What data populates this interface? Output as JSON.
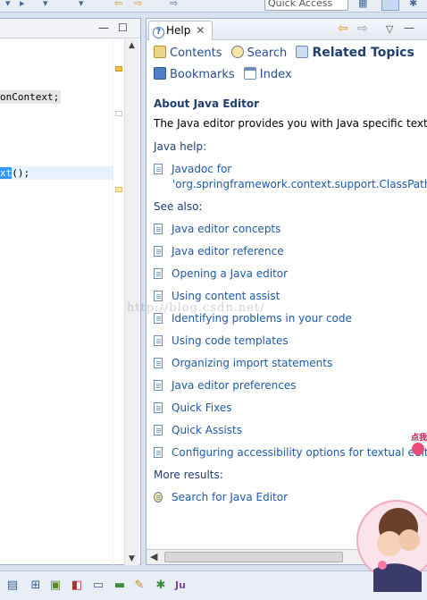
{
  "toolbar": {
    "quick_access_placeholder": "Quick Access"
  },
  "editor": {
    "code_line_1": "onContext;",
    "code_line_2_selected": "xt",
    "code_line_2_rest": "();"
  },
  "help": {
    "tab_label": "Help",
    "nav": {
      "contents": "Contents",
      "search": "Search",
      "related_topics": "Related Topics",
      "bookmarks": "Bookmarks",
      "index": "Index"
    },
    "title": "About Java Editor",
    "intro": "The Java editor provides you with Java specific text e",
    "java_help_heading": "Java help:",
    "javadoc_line1": "Javadoc for",
    "javadoc_line2": "'org.springframework.context.support.ClassPathX",
    "see_also_heading": "See also:",
    "see_also": [
      "Java editor concepts",
      "Java editor reference",
      "Opening a Java editor",
      "Using content assist",
      "Identifying problems in your code",
      "Using code templates",
      "Organizing import statements",
      "Java editor preferences",
      "Quick Fixes",
      "Quick Assists",
      "Configuring accessibility options for textual edito"
    ],
    "more_results_heading": "More results:",
    "search_for": "Search for Java Editor"
  },
  "watermark": "http://blog.csdn.net/",
  "sticker_text": "点我",
  "icons": {
    "help_tab": "help-icon",
    "contents": "contents-icon",
    "search": "search-icon",
    "related": "related-topics-icon",
    "bookmarks": "bookmarks-icon",
    "index": "index-icon",
    "topic": "document-icon"
  },
  "colors": {
    "link": "#1f5aa6",
    "heading": "#1f3f74",
    "selection": "#3399ff",
    "current_line": "#e8f2fe"
  }
}
